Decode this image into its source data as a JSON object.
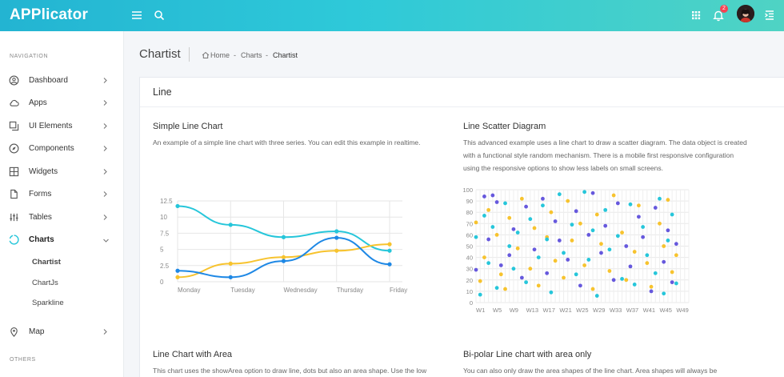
{
  "brand": "APPlicator",
  "notifications_count": "2",
  "sidebar": {
    "nav_heading": "NAVIGATION",
    "items": [
      {
        "label": "Dashboard"
      },
      {
        "label": "Apps"
      },
      {
        "label": "UI Elements"
      },
      {
        "label": "Components"
      },
      {
        "label": "Widgets"
      },
      {
        "label": "Forms"
      },
      {
        "label": "Tables"
      },
      {
        "label": "Charts"
      },
      {
        "label": "Map"
      }
    ],
    "sub_items": [
      {
        "label": "Chartist"
      },
      {
        "label": "ChartJs"
      },
      {
        "label": "Sparkline"
      }
    ],
    "others_heading": "OTHERS"
  },
  "page": {
    "title": "Chartist",
    "breadcrumb": [
      "Home",
      "Charts",
      "Chartist"
    ],
    "breadcrumb_sep": "-"
  },
  "card": {
    "title": "Line",
    "sections": [
      {
        "title": "Simple Line Chart",
        "desc": [
          "An example of a simple line chart with three series. You can edit this example in realtime."
        ]
      },
      {
        "title": "Line Scatter Diagram",
        "desc": [
          "This advanced example uses a line chart to draw a scatter diagram. The data object is created",
          "with a functional style random mechanism. There is a mobile first responsive configuration",
          "using the responsive options to show less labels on small screens."
        ]
      },
      {
        "title": "Line Chart with Area",
        "desc": [
          "This chart uses the showArea option to draw line, dots but also an area shape. Use the low"
        ]
      },
      {
        "title": "Bi-polar Line chart with area only",
        "desc": [
          "You can also only draw the area shapes of the line chart. Area shapes will always be"
        ]
      }
    ]
  },
  "chart_data": [
    {
      "type": "line",
      "title": "Simple Line Chart",
      "categories": [
        "Monday",
        "Tuesday",
        "Wednesday",
        "Thursday",
        "Friday"
      ],
      "y_ticks": [
        "0",
        "2.5",
        "5",
        "7.5",
        "10",
        "12.5"
      ],
      "ylim": [
        0,
        12.5
      ],
      "grid": true,
      "series": [
        {
          "color": "#26c6da",
          "values": [
            11.7,
            8.8,
            6.9,
            7.8,
            4.8
          ]
        },
        {
          "color": "#f7c32e",
          "values": [
            0.7,
            2.8,
            3.8,
            4.8,
            5.8
          ]
        },
        {
          "color": "#1e88e5",
          "values": [
            1.7,
            0.7,
            3.2,
            6.8,
            2.7
          ]
        }
      ]
    },
    {
      "type": "scatter",
      "title": "Line Scatter Diagram",
      "x_ticks": [
        "W1",
        "W5",
        "W9",
        "W13",
        "W17",
        "W21",
        "W25",
        "W29",
        "W33",
        "W37",
        "W41",
        "W45",
        "W49"
      ],
      "y_ticks": [
        "0",
        "10",
        "20",
        "30",
        "40",
        "50",
        "60",
        "70",
        "80",
        "90",
        "100"
      ],
      "ylim": [
        0,
        100
      ],
      "grid": true,
      "series": [
        {
          "color": "#6658dd",
          "points": [
            [
              0,
              29
            ],
            [
              2,
              94
            ],
            [
              3,
              56
            ],
            [
              4,
              95
            ],
            [
              5,
              89
            ],
            [
              6,
              33
            ],
            [
              8,
              42
            ],
            [
              9,
              65
            ],
            [
              11,
              22
            ],
            [
              12,
              85
            ],
            [
              14,
              47
            ],
            [
              16,
              92
            ],
            [
              17,
              26
            ],
            [
              19,
              72
            ],
            [
              20,
              55
            ],
            [
              22,
              38
            ],
            [
              24,
              81
            ],
            [
              25,
              15
            ],
            [
              27,
              60
            ],
            [
              28,
              97
            ],
            [
              30,
              44
            ],
            [
              31,
              68
            ],
            [
              33,
              20
            ],
            [
              34,
              88
            ],
            [
              36,
              50
            ],
            [
              37,
              32
            ],
            [
              39,
              76
            ],
            [
              40,
              58
            ],
            [
              42,
              10
            ],
            [
              43,
              84
            ],
            [
              45,
              36
            ],
            [
              46,
              64
            ],
            [
              47,
              18
            ],
            [
              48,
              52
            ]
          ]
        },
        {
          "color": "#f7c32e",
          "points": [
            [
              0,
              71
            ],
            [
              1,
              19
            ],
            [
              2,
              40
            ],
            [
              3,
              82
            ],
            [
              5,
              60
            ],
            [
              6,
              25
            ],
            [
              7,
              12
            ],
            [
              8,
              75
            ],
            [
              10,
              48
            ],
            [
              11,
              92
            ],
            [
              13,
              30
            ],
            [
              14,
              66
            ],
            [
              15,
              15
            ],
            [
              17,
              58
            ],
            [
              18,
              80
            ],
            [
              19,
              37
            ],
            [
              21,
              22
            ],
            [
              22,
              90
            ],
            [
              23,
              55
            ],
            [
              25,
              70
            ],
            [
              26,
              33
            ],
            [
              28,
              12
            ],
            [
              29,
              78
            ],
            [
              30,
              52
            ],
            [
              32,
              28
            ],
            [
              33,
              95
            ],
            [
              35,
              62
            ],
            [
              36,
              20
            ],
            [
              38,
              45
            ],
            [
              39,
              86
            ],
            [
              41,
              35
            ],
            [
              42,
              14
            ],
            [
              44,
              70
            ],
            [
              45,
              50
            ],
            [
              46,
              91
            ],
            [
              47,
              27
            ],
            [
              48,
              42
            ]
          ]
        },
        {
          "color": "#26c6da",
          "points": [
            [
              0,
              58
            ],
            [
              1,
              7
            ],
            [
              2,
              77
            ],
            [
              3,
              35
            ],
            [
              4,
              67
            ],
            [
              5,
              13
            ],
            [
              7,
              88
            ],
            [
              8,
              50
            ],
            [
              9,
              30
            ],
            [
              10,
              62
            ],
            [
              12,
              18
            ],
            [
              13,
              74
            ],
            [
              15,
              40
            ],
            [
              16,
              86
            ],
            [
              17,
              56
            ],
            [
              18,
              9
            ],
            [
              20,
              96
            ],
            [
              21,
              44
            ],
            [
              23,
              69
            ],
            [
              24,
              25
            ],
            [
              26,
              98
            ],
            [
              27,
              38
            ],
            [
              28,
              64
            ],
            [
              29,
              6
            ],
            [
              31,
              82
            ],
            [
              32,
              47
            ],
            [
              34,
              59
            ],
            [
              35,
              21
            ],
            [
              37,
              87
            ],
            [
              38,
              16
            ],
            [
              40,
              67
            ],
            [
              41,
              42
            ],
            [
              43,
              26
            ],
            [
              44,
              92
            ],
            [
              45,
              8
            ],
            [
              46,
              55
            ],
            [
              47,
              78
            ],
            [
              48,
              17
            ]
          ]
        }
      ]
    }
  ]
}
